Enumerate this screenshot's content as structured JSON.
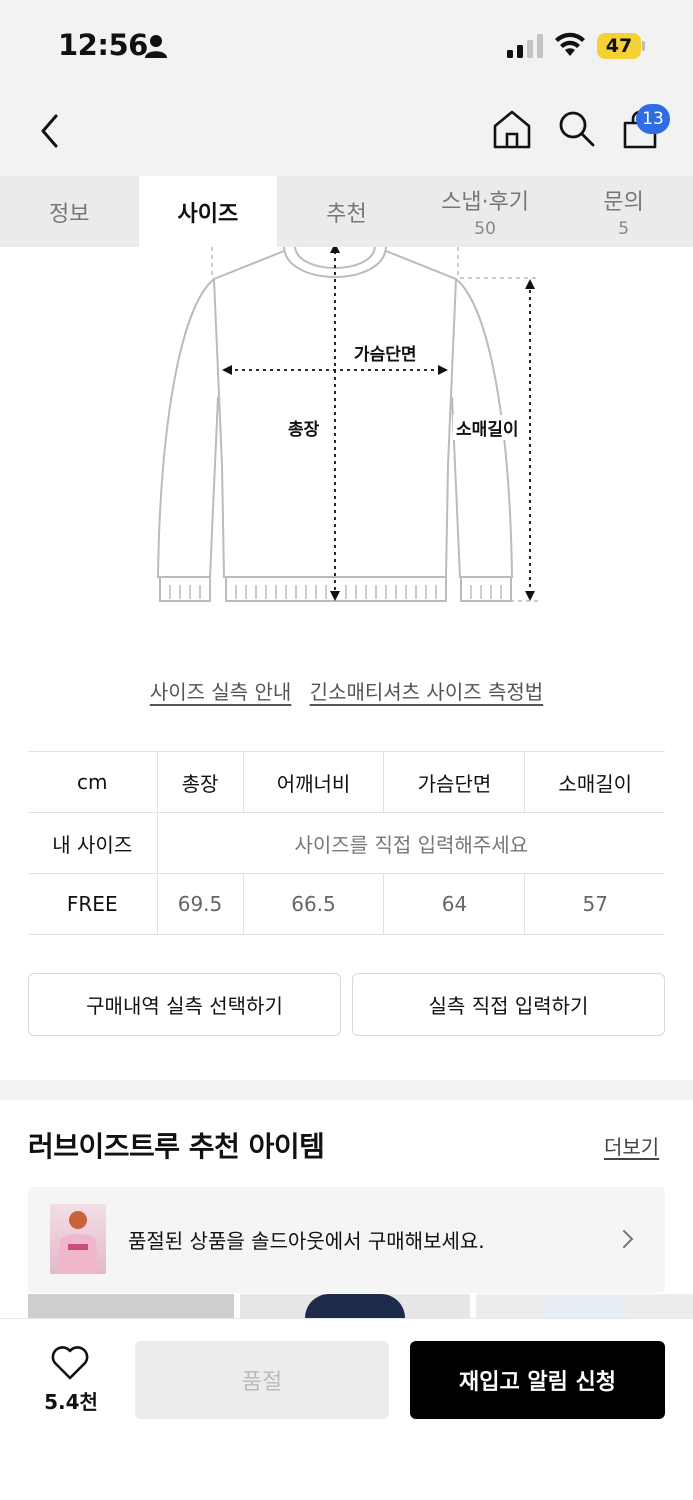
{
  "status_bar": {
    "time": "12:56",
    "battery": "47"
  },
  "header": {
    "cart_count": "13"
  },
  "tabs": [
    {
      "label": "정보",
      "count": ""
    },
    {
      "label": "사이즈",
      "count": ""
    },
    {
      "label": "추천",
      "count": ""
    },
    {
      "label": "스냅·후기",
      "count": "50"
    },
    {
      "label": "문의",
      "count": "5"
    }
  ],
  "diagram": {
    "chest": "가슴단면",
    "length": "총장",
    "sleeve": "소매길이"
  },
  "guide_links": {
    "actual_size_guide": "사이즈 실측 안내",
    "measure_method": "긴소매티셔츠 사이즈 측정법"
  },
  "size_table": {
    "unit": "cm",
    "headers": [
      "총장",
      "어깨너비",
      "가슴단면",
      "소매길이"
    ],
    "my_size_label": "내 사이즈",
    "my_size_placeholder": "사이즈를 직접 입력해주세요",
    "rows": [
      {
        "size": "FREE",
        "values": [
          "69.5",
          "66.5",
          "64",
          "57"
        ]
      }
    ]
  },
  "buttons": {
    "select_purchase": "구매내역 실측 선택하기",
    "direct_input": "실측 직접 입력하기"
  },
  "recommend": {
    "title": "러브이즈트루 추천 아이템",
    "more": "더보기",
    "banner_text": "품절된 상품을 솔드아웃에서 구매해보세요."
  },
  "bottom_bar": {
    "likes": "5.4천",
    "sold_out": "품절",
    "restock": "재입고 알림 신청"
  }
}
